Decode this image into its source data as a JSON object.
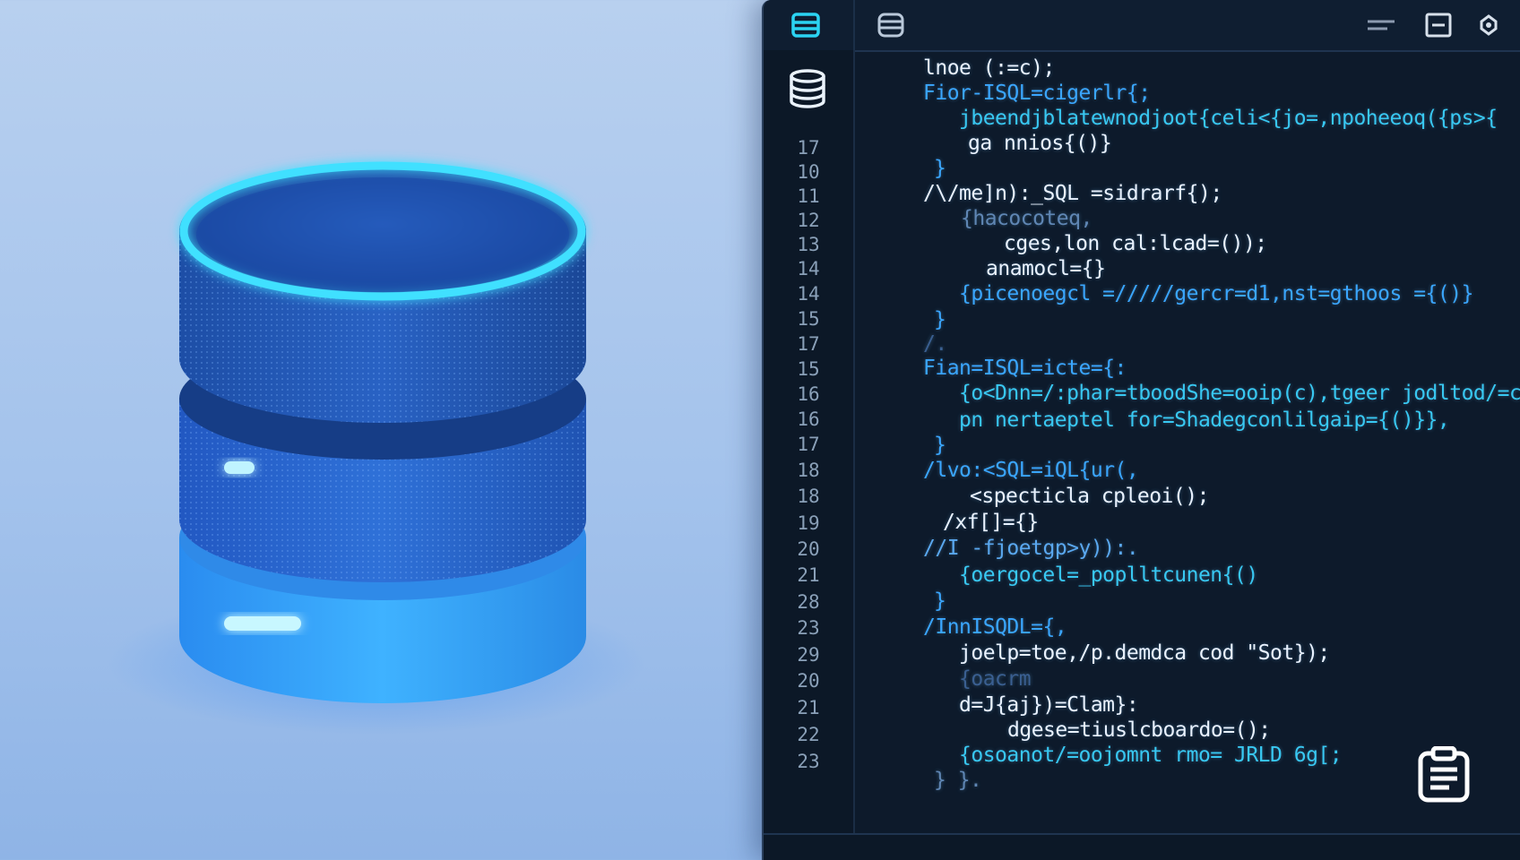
{
  "toolbar": {
    "icons": [
      "table-icon",
      "database-stack-icon",
      "align-icon",
      "panel-icon",
      "refresh-icon"
    ]
  },
  "sidebar": {
    "icon": "database-icon"
  },
  "colors": {
    "editor_bg": "#0d1a2b",
    "accent_cyan": "#34d0f5",
    "code_blue": "#3aa6ff",
    "code_white": "#e9f2ff",
    "line_number": "#8aa0b8"
  },
  "editor": {
    "line_numbers": [
      "17",
      "10",
      "11",
      "12",
      "13",
      "14",
      "14",
      "15",
      "17",
      "15",
      "16",
      "16",
      "17",
      "18",
      "18",
      "19",
      "20",
      "21",
      "28",
      "23",
      "29",
      "20",
      "21",
      "22",
      "23"
    ],
    "lines": [
      "lnoe (:=c);",
      "Fior-ISQL=cigerlr{;",
      "jbeendjblatewnodjoot{celi<{jo=,npoheeoq({ps>{",
      "ga nnios{()}",
      "}",
      "/\\/me]n):_SQL =sidrarf{);",
      "{hacocoteq,",
      "cges,lon cal:lcad=());",
      "anamocl={}",
      "{picenoegcl =/////gercr=d1,nst=gthoos ={()}",
      "}",
      "/.",
      "Fian=ISQL=icte={:",
      "{o<Dnn=/:phar=tboodShe=ooip(c),tgeer jodltod/=c",
      "pn nertaeptel for=Shadegconlilgaip={()}},",
      "}",
      "/lvo:<SQL=iQL{ur(,",
      "<specticla cpleoi();",
      "/xf[]={}",
      "//I -fjoetgp>y)):.",
      "{oergocel=_poplltcunen{()",
      "}",
      "/InnISQDL={,",
      "joelp=toe,/p.demdca cod \"Sot});",
      "{oacrm",
      "d=J{aj})=Clam}:",
      "dgese=tiuslcboardo=();",
      "{osoanot/=oojomnt rmo= JRLD 6g[;",
      "} }."
    ]
  },
  "clipboard": {
    "icon": "clipboard-icon"
  }
}
